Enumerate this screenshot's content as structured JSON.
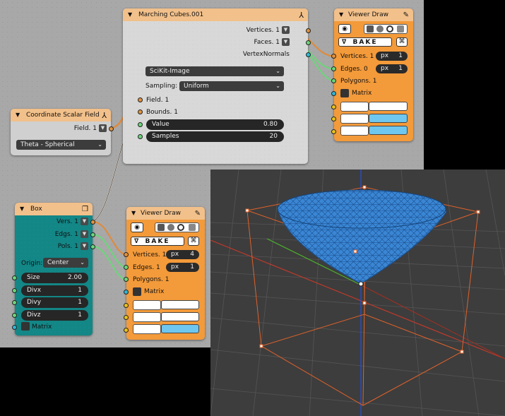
{
  "marching_cubes": {
    "title": "Marching Cubes.001",
    "outputs": [
      "Vertices. 1",
      "Faces. 1",
      "VertexNormals"
    ],
    "method": "SciKit-Image",
    "sampling_label": "Sampling:",
    "sampling": "Uniform",
    "inputs": [
      "Field. 1",
      "Bounds. 1"
    ],
    "value_label": "Value",
    "value": "0.80",
    "samples_label": "Samples",
    "samples": "20"
  },
  "coordinate_field": {
    "title": "Coordinate Scalar Field",
    "output": "Field. 1",
    "mode": "Theta - Spherical"
  },
  "box": {
    "title": "Box",
    "outputs": [
      "Vers. 1",
      "Edgs. 1",
      "Pols. 1"
    ],
    "origin_label": "Origin:",
    "origin": "Center",
    "size_label": "Size",
    "size": "2.00",
    "divx_label": "Divx",
    "divx": "1",
    "divy_label": "Divy",
    "divy": "1",
    "divz_label": "Divz",
    "divz": "1",
    "matrix_label": "Matrix"
  },
  "viewer_top": {
    "title": "Viewer Draw",
    "bake": "BAKE",
    "vertices": "Vertices. 1",
    "vertices_unit": "px",
    "vertices_size": "1",
    "edges": "Edges. 0",
    "edges_unit": "px",
    "edges_size": "1",
    "polygons": "Polygons. 1",
    "matrix": "Matrix"
  },
  "viewer_bottom": {
    "title": "Viewer Draw",
    "bake": "BAKE",
    "vertices": "Vertices. 1",
    "vertices_unit": "px",
    "vertices_size": "4",
    "edges": "Edges. 1",
    "edges_unit": "px",
    "edges_size": "1",
    "polygons": "Polygons. 1",
    "matrix": "Matrix"
  },
  "colors": {
    "node_orange": "#f39a3a",
    "node_teal": "#138686",
    "node_header": "#f2c08a",
    "socket_orange": "#e0913e",
    "socket_green": "#6bd67a",
    "socket_cyan": "#2eb7d6",
    "socket_yellow": "#e8c318",
    "mesh_blue": "#3a86d4",
    "box_edge": "#e0622a",
    "axis_green": "#4caf2c",
    "axis_red": "#c0392b",
    "axis_blue": "#2b4fd6"
  },
  "icons": [
    "wrench-icon",
    "pencil-icon",
    "eye-icon",
    "collapse-arrow-icon",
    "box-node-icon"
  ]
}
